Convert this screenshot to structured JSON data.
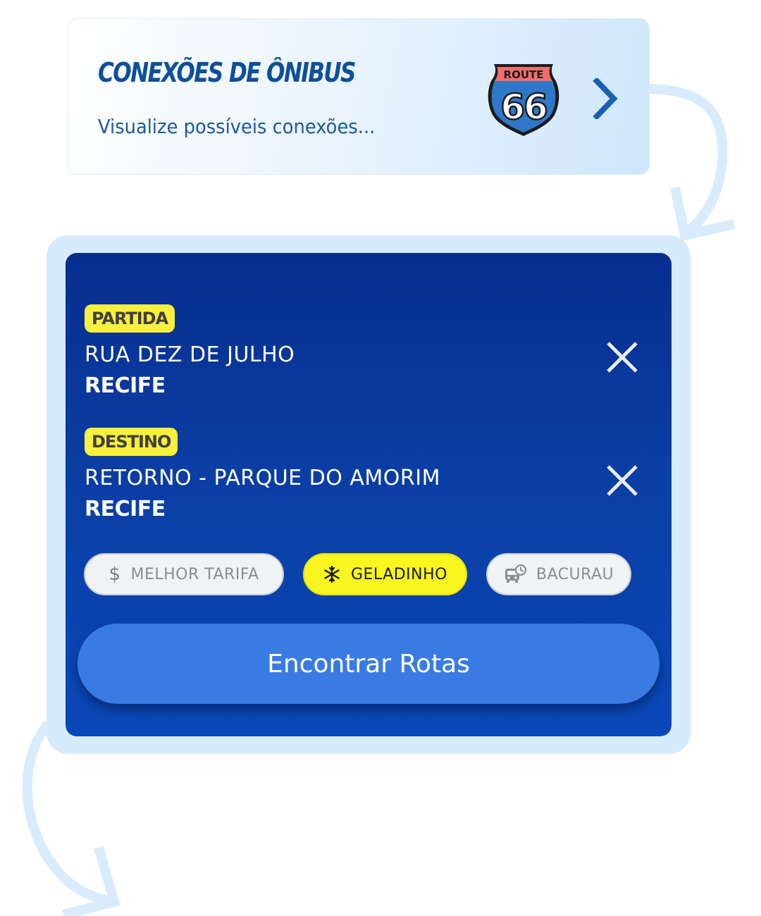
{
  "connections_card": {
    "title": "CONEXÕES DE ÔNIBUS",
    "subtitle": "Visualize possíveis conexões...",
    "route_icon": "route-66-shield-icon",
    "route_icon_top_text": "ROUTE",
    "route_icon_number": "66",
    "chevron_icon": "chevron-right-icon"
  },
  "search": {
    "origin": {
      "badge": "PARTIDA",
      "street": "RUA DEZ DE JULHO",
      "city": "RECIFE",
      "clear_icon": "close-icon"
    },
    "destination": {
      "badge": "DESTINO",
      "street": "RETORNO - PARQUE DO AMORIM",
      "city": "RECIFE",
      "clear_icon": "close-icon"
    },
    "filters": [
      {
        "label": "MELHOR TARIFA",
        "icon": "dollar-icon",
        "selected": false
      },
      {
        "label": "GELADINHO",
        "icon": "snowflake-icon",
        "selected": true
      },
      {
        "label": "BACURAU",
        "icon": "night-bus-icon",
        "selected": false
      }
    ],
    "submit_label": "Encontrar Rotas"
  },
  "colors": {
    "accent_yellow": "#f7f03c",
    "panel_blue": "#0b3ea3",
    "button_blue": "#3a7be3",
    "title_blue": "#0d4f9a"
  }
}
